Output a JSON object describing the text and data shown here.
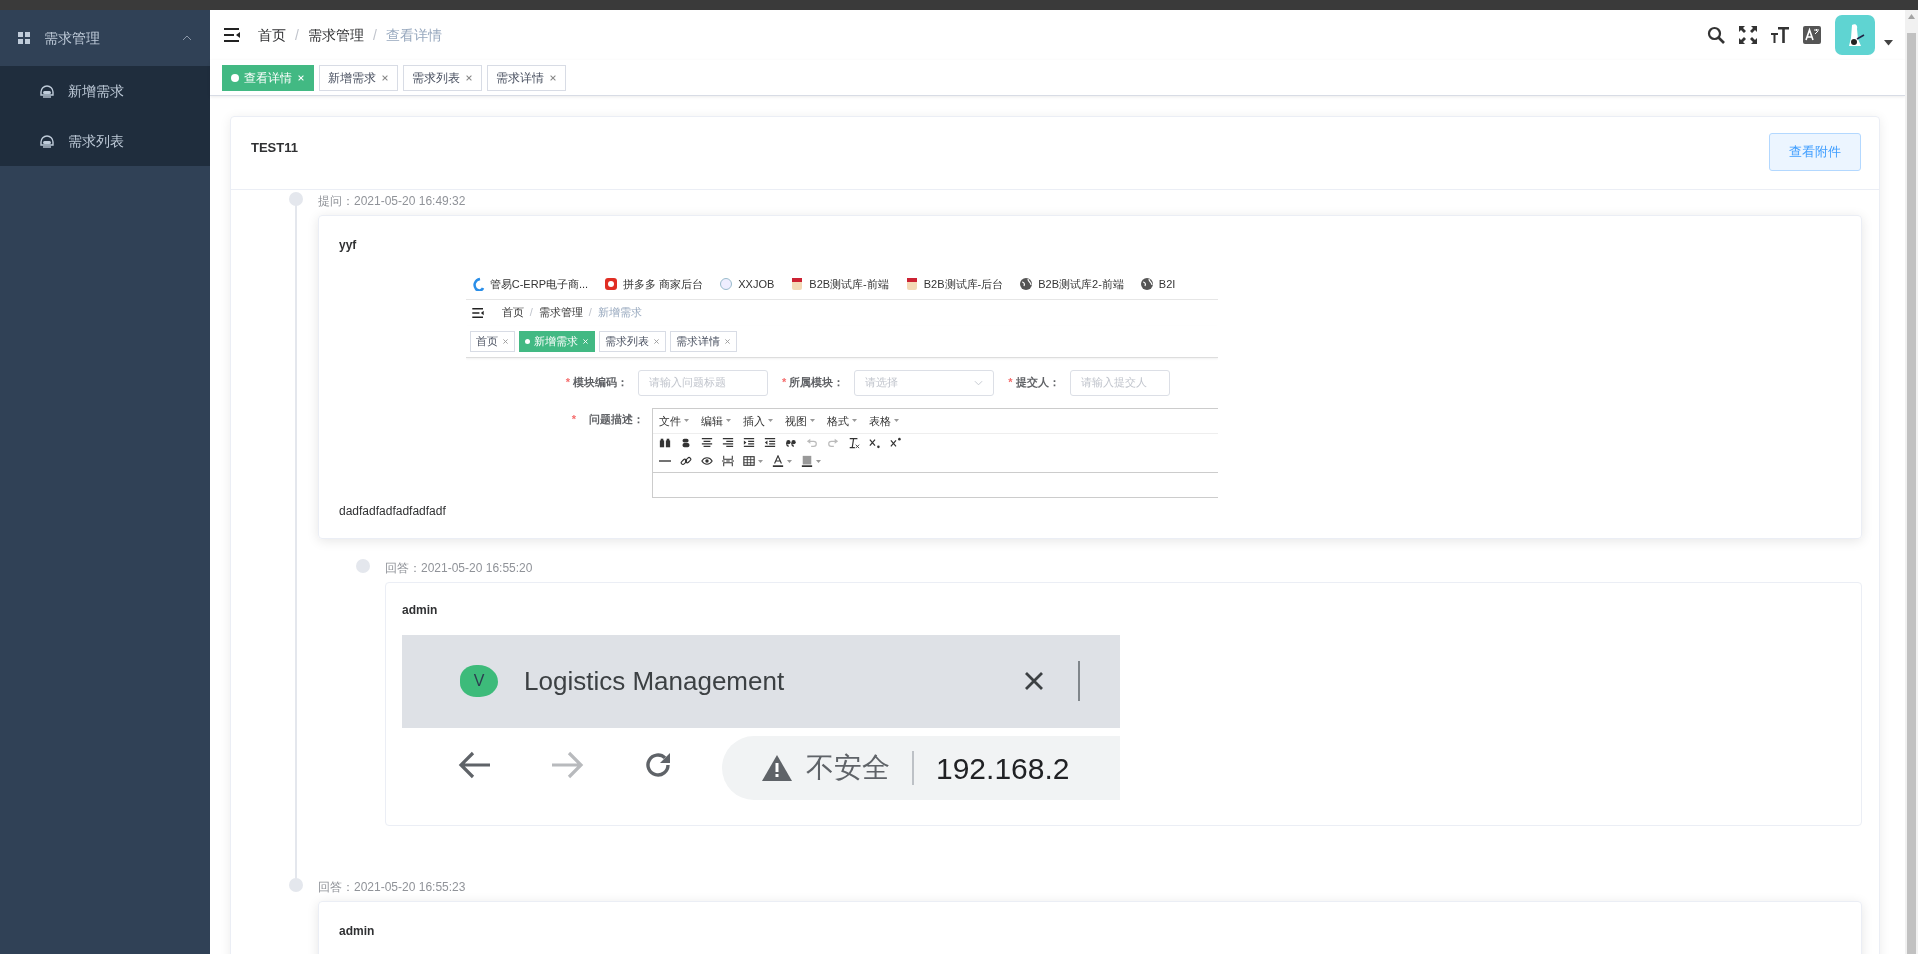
{
  "sidebar": {
    "menu": {
      "label": "需求管理",
      "expanded": true,
      "children": [
        {
          "label": "新增需求",
          "selected": false
        },
        {
          "label": "需求列表",
          "selected": false
        }
      ]
    }
  },
  "breadcrumb": {
    "separator": "/",
    "items": [
      {
        "label": "首页",
        "current": false
      },
      {
        "label": "需求管理",
        "current": false
      },
      {
        "label": "查看详情",
        "current": true
      }
    ]
  },
  "tabs": [
    {
      "label": "查看详情",
      "selected": true
    },
    {
      "label": "新增需求",
      "selected": false
    },
    {
      "label": "需求列表",
      "selected": false
    },
    {
      "label": "需求详情",
      "selected": false
    }
  ],
  "detail": {
    "title": "TEST11",
    "attachment_button": "查看附件"
  },
  "timeline": [
    {
      "label": "提问：2021-05-20 16:49:32",
      "author": "yyf",
      "text": "dadfadfadfadfadfadf",
      "screenshot": {
        "kind": "erp",
        "bookmarks": [
          {
            "label": "管易C-ERP电子商...",
            "kind": "swirl"
          },
          {
            "label": "拼多多 商家后台",
            "kind": "flower"
          },
          {
            "label": "XXJOB",
            "kind": "ring"
          },
          {
            "label": "B2B测试库-前端",
            "kind": "figure"
          },
          {
            "label": "B2B测试库-后台",
            "kind": "figure"
          },
          {
            "label": "B2B测试库2-前端",
            "kind": "globe"
          },
          {
            "label": "B2I",
            "kind": "globe"
          }
        ],
        "breadcrumb": {
          "separator": "/",
          "items": [
            {
              "label": "首页",
              "current": false
            },
            {
              "label": "需求管理",
              "current": false
            },
            {
              "label": "新增需求",
              "current": true
            }
          ]
        },
        "tabs": [
          {
            "label": "首页",
            "selected": false
          },
          {
            "label": "新增需求",
            "selected": true
          },
          {
            "label": "需求列表",
            "selected": false
          },
          {
            "label": "需求详情",
            "selected": false
          }
        ],
        "required_mark": "*",
        "fields": [
          {
            "label": "模块编码：",
            "required": true,
            "kind": "input",
            "placeholder": "请输入问题标题"
          },
          {
            "label": "所属模块：",
            "required": true,
            "kind": "select",
            "placeholder": "请选择"
          },
          {
            "label": "提交人：",
            "required": true,
            "kind": "input",
            "placeholder": "请输入提交人"
          }
        ],
        "editor": {
          "label": "问题描述：",
          "required": true,
          "menus": [
            "文件",
            "编辑",
            "插入",
            "视图",
            "格式",
            "表格"
          ],
          "toolbar": [
            [
              {
                "kind": "find"
              },
              {
                "kind": "bold"
              },
              {
                "kind": "align-center"
              },
              {
                "kind": "align-right"
              },
              {
                "kind": "indent"
              },
              {
                "kind": "outdent"
              },
              {
                "kind": "quote"
              },
              {
                "kind": "undo"
              },
              {
                "kind": "redo"
              },
              {
                "kind": "clear-format"
              },
              {
                "kind": "subscript"
              },
              {
                "kind": "superscript"
              }
            ],
            [
              {
                "kind": "rule"
              },
              {
                "kind": "link"
              },
              {
                "kind": "preview"
              },
              {
                "kind": "page-break"
              },
              {
                "kind": "table"
              },
              {
                "kind": "text-color"
              },
              {
                "kind": "highlight"
              }
            ]
          ]
        }
      },
      "children": [
        {
          "label": "回答：2021-05-20 16:55:20",
          "author": "admin",
          "screenshot": {
            "kind": "browser",
            "logo_letter": "V",
            "tab_title": "Logistics Management",
            "security": "不安全",
            "url": "192.168.2"
          }
        }
      ]
    },
    {
      "label": "回答：2021-05-20 16:55:23",
      "author": "admin"
    }
  ]
}
